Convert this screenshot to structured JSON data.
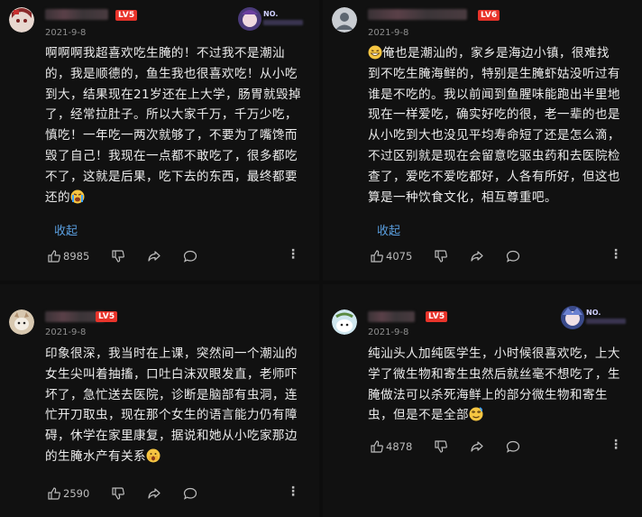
{
  "comments": [
    {
      "id": "c1",
      "level": "LV5",
      "date": "2021-9-8",
      "badge_text": "NO.",
      "lines": [
        "啊啊啊我超喜欢吃生腌的！不过我不是潮汕",
        "的，我是顺德的，鱼生我也很喜欢吃！从小吃",
        "到大，结果现在21岁还在上大学，肠胃就毁掉",
        "了，经常拉肚子。所以大家千万，千万少吃，",
        "慎吃！一年吃一两次就够了，不要为了嘴馋而",
        "毁了自己！我现在一点都不敢吃了，很多都吃",
        "不了，这就是后果，吃下去的东西，最终都要",
        "还的"
      ],
      "fold_label": "收起",
      "likes": "8985",
      "trailing_emoji": "sob-emoji"
    },
    {
      "id": "c2",
      "level": "LV6",
      "date": "2021-9-8",
      "lines": [
        "俺也是潮汕的，家乡是海边小镇，很难找",
        "到不吃生腌海鲜的，特别是生腌虾姑没听过有",
        "谁是不吃的。我以前闻到鱼腥味能跑出半里地",
        "现在一样爱吃，确实好吃的很，老一辈的也是",
        "从小吃到大也没见平均寿命短了还是怎么滴，",
        "不过区别就是现在会留意吃驱虫药和去医院检",
        "查了，爱吃不爱吃都好，人各有所好，但这也",
        "算是一种饮食文化，相互尊重吧。"
      ],
      "fold_label": "收起",
      "likes": "4075",
      "leading_emoji": "grin-emoji"
    },
    {
      "id": "c3",
      "level": "LV5",
      "date": "2021-9-8",
      "lines": [
        "印象很深，我当时在上课，突然间一个潮汕的",
        "女生尖叫着抽搐，口吐白沫双眼发直，老师吓",
        "坏了，急忙送去医院，诊断是脑部有虫洞，连",
        "忙开刀取虫，现在那个女生的语言能力仍有障",
        "碍，休学在家里康复，据说和她从小吃家那边",
        "的生腌水产有关系"
      ],
      "likes": "2590",
      "trailing_emoji": "shocked-emoji"
    },
    {
      "id": "c4",
      "level": "LV5",
      "date": "2021-9-8",
      "badge_text": "NO.",
      "lines": [
        "纯汕头人加纯医学生，小时候很喜欢吃，上大",
        "学了微生物和寄生虫然后就丝毫不想吃了，生",
        "腌做法可以杀死海鲜上的部分微生物和寄生",
        "虫，但是不是全部"
      ],
      "likes": "4878",
      "trailing_emoji": "dizzy-emoji"
    }
  ],
  "more_glyph": "⋮",
  "colors": {
    "level_badge": "#e8332a",
    "fold_link": "#5a9fe0",
    "background": "#111111"
  }
}
